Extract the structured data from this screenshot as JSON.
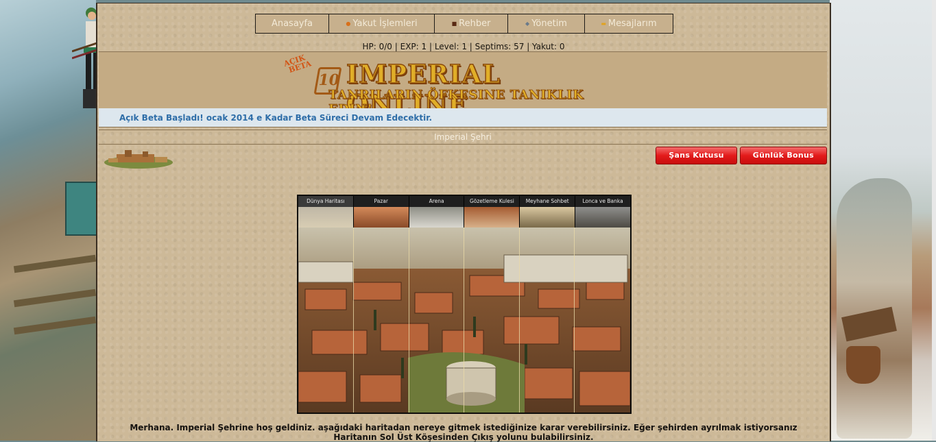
{
  "nav": {
    "items": [
      {
        "label": "Anasayfa",
        "icon": ""
      },
      {
        "label": "Yakut İşlemleri",
        "icon": "ruby-icon"
      },
      {
        "label": "Rehber",
        "icon": "guide-icon"
      },
      {
        "label": "Yönetim",
        "icon": "admin-icon"
      },
      {
        "label": "Mesajlarım",
        "icon": "mail-icon"
      }
    ]
  },
  "status": {
    "text": "HP: 0/0 | EXP: 1 | Level: 1 | Septims: 57 | Yakut: 0"
  },
  "logo": {
    "beta_top": "AÇIK",
    "beta_bottom": "BETA",
    "badge": "10",
    "title": "IMPERIAL ONLINE",
    "subtitle": "TANRILARIN ÖFKESINE TANIKLIK EDIN!"
  },
  "announcement": {
    "text": "Açık Beta Başladı! ocak 2014 e Kadar Beta Süreci Devam Edecektir."
  },
  "section": {
    "title": "Imperial Şehri"
  },
  "buttons": {
    "luck_box": "Şans Kutusu",
    "daily_bonus": "Günlük Bonus"
  },
  "gallery": {
    "tabs": [
      {
        "label": "Dünya Haritası",
        "active": true
      },
      {
        "label": "Pazar",
        "active": false
      },
      {
        "label": "Arena",
        "active": false
      },
      {
        "label": "Gözetleme Kulesi",
        "active": false
      },
      {
        "label": "Meyhane Sohbet",
        "active": false
      },
      {
        "label": "Lonca ve Banka",
        "active": false
      }
    ]
  },
  "caption": {
    "line1": "Merhana. Imperial Şehrine hoş geldiniz. aşağıdaki haritadan nereye gitmek istediğinize karar verebilirsiniz. Eğer şehirden ayrılmak istiyorsanız",
    "line2": "Haritanın Sol Üst Köşesinden Çıkış yolunu bulabilirsiniz."
  },
  "colors": {
    "parchment": "#cdb998",
    "announce_bg": "#dde7ee",
    "announce_text": "#2f6ea8",
    "button_red": "#e31b1b",
    "logo_gold": "#e0ae28"
  }
}
